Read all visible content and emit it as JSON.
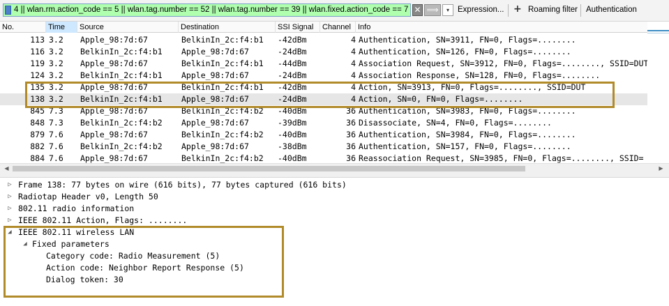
{
  "filter": {
    "text": "4 || wlan.rm.action_code == 5 || wlan.tag.number == 52 || wlan.tag.number == 39 || wlan.fixed.action_code == 7",
    "clear_glyph": "✕",
    "apply_glyph": "⟹",
    "dropdown_glyph": "▾"
  },
  "toolbar": {
    "expression_label": "Expression...",
    "plus_glyph": "+",
    "roaming_label": "Roaming filter",
    "auth_label": "Authentication"
  },
  "columns": [
    "No.",
    "Time",
    "Source",
    "Destination",
    "SSI Signal",
    "Channel",
    "Info"
  ],
  "packets": [
    {
      "no": "113",
      "time": "3.2",
      "source": "Apple_98:7d:67",
      "destination": "BelkinIn_2c:f4:b1",
      "signal": "-42dBm",
      "channel": "4",
      "info": "Authentication, SN=3911, FN=0, Flags=........"
    },
    {
      "no": "116",
      "time": "3.2",
      "source": "BelkinIn_2c:f4:b1",
      "destination": "Apple_98:7d:67",
      "signal": "-24dBm",
      "channel": "4",
      "info": "Authentication, SN=126, FN=0, Flags=........"
    },
    {
      "no": "119",
      "time": "3.2",
      "source": "Apple_98:7d:67",
      "destination": "BelkinIn_2c:f4:b1",
      "signal": "-44dBm",
      "channel": "4",
      "info": "Association Request, SN=3912, FN=0, Flags=........, SSID=DUT"
    },
    {
      "no": "124",
      "time": "3.2",
      "source": "BelkinIn_2c:f4:b1",
      "destination": "Apple_98:7d:67",
      "signal": "-24dBm",
      "channel": "4",
      "info": "Association Response, SN=128, FN=0, Flags=........"
    },
    {
      "no": "135",
      "time": "3.2",
      "source": "Apple_98:7d:67",
      "destination": "BelkinIn_2c:f4:b1",
      "signal": "-42dBm",
      "channel": "4",
      "info": "Action, SN=3913, FN=0, Flags=........, SSID=DUT"
    },
    {
      "no": "138",
      "time": "3.2",
      "source": "BelkinIn_2c:f4:b1",
      "destination": "Apple_98:7d:67",
      "signal": "-24dBm",
      "channel": "4",
      "info": "Action, SN=0, FN=0, Flags=........"
    },
    {
      "no": "845",
      "time": "7.3",
      "source": "Apple_98:7d:67",
      "destination": "BelkinIn_2c:f4:b2",
      "signal": "-40dBm",
      "channel": "36",
      "info": "Authentication, SN=3983, FN=0, Flags=........"
    },
    {
      "no": "848",
      "time": "7.3",
      "source": "BelkinIn_2c:f4:b2",
      "destination": "Apple_98:7d:67",
      "signal": "-39dBm",
      "channel": "36",
      "info": "Disassociate, SN=4, FN=0, Flags=........"
    },
    {
      "no": "879",
      "time": "7.6",
      "source": "Apple_98:7d:67",
      "destination": "BelkinIn_2c:f4:b2",
      "signal": "-40dBm",
      "channel": "36",
      "info": "Authentication, SN=3984, FN=0, Flags=........"
    },
    {
      "no": "882",
      "time": "7.6",
      "source": "BelkinIn_2c:f4:b2",
      "destination": "Apple_98:7d:67",
      "signal": "-38dBm",
      "channel": "36",
      "info": "Authentication, SN=157, FN=0, Flags=........"
    },
    {
      "no": "884",
      "time": "7.6",
      "source": "Apple_98:7d:67",
      "destination": "BelkinIn_2c:f4:b2",
      "signal": "-40dBm",
      "channel": "36",
      "info": "Reassociation Request, SN=3985, FN=0, Flags=........, SSID="
    }
  ],
  "selected_packet_index": 5,
  "details": [
    {
      "text": "Frame 138: 77 bytes on wire (616 bits), 77 bytes captured (616 bits)",
      "expanded": false
    },
    {
      "text": "Radiotap Header v0, Length 50",
      "expanded": false
    },
    {
      "text": "802.11 radio information",
      "expanded": false
    },
    {
      "text": "IEEE 802.11 Action, Flags: ........",
      "expanded": false
    },
    {
      "text": "IEEE 802.11 wireless LAN",
      "expanded": true
    },
    {
      "text": "Fixed parameters",
      "expanded": true
    },
    {
      "text": "Category code: Radio Measurement (5)",
      "expanded": null
    },
    {
      "text": "Action code: Neighbor Report Response (5)",
      "expanded": null
    },
    {
      "text": "Dialog token: 30",
      "expanded": null
    }
  ],
  "icons": {
    "collapsed": "▷",
    "expanded": "◢",
    "scroll_left": "◀",
    "scroll_right": "▶"
  },
  "colors": {
    "filter_valid": "#afffaf",
    "selected_row": "#e6e6e6",
    "highlight_box": "#b18a2a"
  }
}
